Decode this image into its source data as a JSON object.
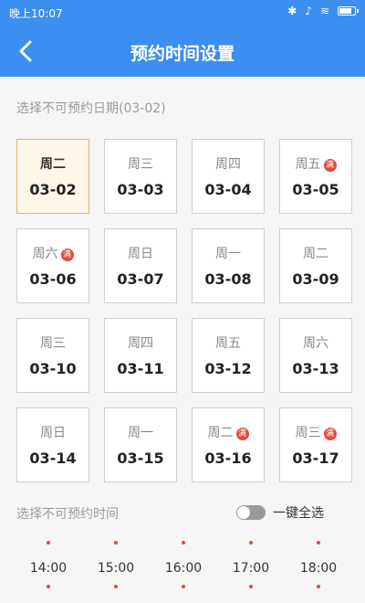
{
  "status_bar": {
    "time": "晚上10:07"
  },
  "header": {
    "title": "预约时间设置"
  },
  "date_section": {
    "label": "选择不可预约日期(03-02)"
  },
  "dates": [
    {
      "weekday": "周二",
      "date": "03-02",
      "full": false,
      "selected": true
    },
    {
      "weekday": "周三",
      "date": "03-03",
      "full": false,
      "selected": false
    },
    {
      "weekday": "周四",
      "date": "03-04",
      "full": false,
      "selected": false
    },
    {
      "weekday": "周五",
      "date": "03-05",
      "full": true,
      "selected": false
    },
    {
      "weekday": "周六",
      "date": "03-06",
      "full": true,
      "selected": false
    },
    {
      "weekday": "周日",
      "date": "03-07",
      "full": false,
      "selected": false
    },
    {
      "weekday": "周一",
      "date": "03-08",
      "full": false,
      "selected": false
    },
    {
      "weekday": "周二",
      "date": "03-09",
      "full": false,
      "selected": false
    },
    {
      "weekday": "周三",
      "date": "03-10",
      "full": false,
      "selected": false
    },
    {
      "weekday": "周四",
      "date": "03-11",
      "full": false,
      "selected": false
    },
    {
      "weekday": "周五",
      "date": "03-12",
      "full": false,
      "selected": false
    },
    {
      "weekday": "周六",
      "date": "03-13",
      "full": false,
      "selected": false
    },
    {
      "weekday": "周日",
      "date": "03-14",
      "full": false,
      "selected": false
    },
    {
      "weekday": "周一",
      "date": "03-15",
      "full": false,
      "selected": false
    },
    {
      "weekday": "周二",
      "date": "03-16",
      "full": true,
      "selected": false
    },
    {
      "weekday": "周三",
      "date": "03-17",
      "full": true,
      "selected": false
    }
  ],
  "badge_text": "满",
  "time_section": {
    "label": "选择不可预约时间",
    "select_all_label": "一键全选",
    "select_all_on": false
  },
  "times": [
    "14:00",
    "15:00",
    "16:00",
    "17:00",
    "18:00"
  ],
  "colors": {
    "primary": "#3c8ef1",
    "badge": "#e04b3b",
    "selected_border": "#f4b16a",
    "selected_bg": "#fff6ea"
  }
}
